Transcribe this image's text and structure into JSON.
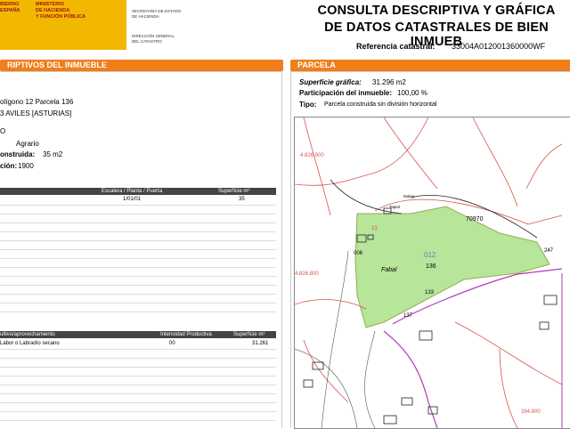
{
  "header": {
    "logo_left_lines": [
      "BIERNO",
      "ESPAÑA"
    ],
    "logo_right_lines": [
      "MINISTERIO",
      "DE HACIENDA",
      "Y FUNCIÓN PÚBLICA"
    ],
    "secretaria_lines": [
      "SECRETARÍA DE ESTADO",
      "DE HACIENDA"
    ],
    "direccion_lines": [
      "DIRECCIÓN GENERAL",
      "DEL CATASTRO"
    ],
    "title_line1": "CONSULTA DESCRIPTIVA Y GRÁFICA",
    "title_line2": "DE DATOS CATASTRALES DE BIEN INMUEB",
    "ref_label": "Referencia catastral:",
    "ref_value": "33004A012001360000WF"
  },
  "left": {
    "bar_title": "RIPTIVOS DEL INMUEBLE",
    "address1": "olígono 12 Parcela 136",
    "address2": "3 AVILES [ASTURIAS]",
    "clase_frag": "O",
    "uso_value": "Agrario",
    "construida_label": "onstruida:",
    "construida_value": "35 m2",
    "anio_label": "ción:",
    "anio_value": "1900",
    "construccion_head": {
      "col1": "Escalera / Planta / Puerta",
      "col2": "Superficie m²"
    },
    "construccion_rows": [
      {
        "planta": "1/01/01",
        "sup": "35"
      }
    ],
    "cultivo_head": {
      "col0": "ultivo/aprovechamiento",
      "col1": "Intensidad Productiva",
      "col2": "Superficie m²"
    },
    "cultivo_rows": [
      {
        "cultivo": "Labor o Labradío secano",
        "intensidad": "00",
        "sup": "31.261"
      }
    ]
  },
  "right": {
    "bar_title": "PARCELA",
    "sup_label": "Superficie gráfica:",
    "sup_value": "31.296 m2",
    "part_label": "Participación del inmueble:",
    "part_value": "100,00 %",
    "tipo_label": "Tipo:",
    "tipo_value": "Parcela construida sin división horizontal"
  },
  "map": {
    "coord_top": "4.826.900",
    "coord_mid": "4.826.800",
    "coord_bottom": "264.800",
    "label_012": "012",
    "label_136": "136",
    "label_fabal": "Fabal",
    "label_70970": "70970",
    "label_247": "247",
    "label_133": "133",
    "label_137": "137",
    "label_006": "006",
    "label_ref13": "13",
    "label_pilar": "Molno",
    "label_tapia": "Tapial",
    "colors": {
      "parcel_fill": "#b7e59a",
      "boundary_red": "#d9534f",
      "boundary_purple": "#b03cb8"
    }
  }
}
